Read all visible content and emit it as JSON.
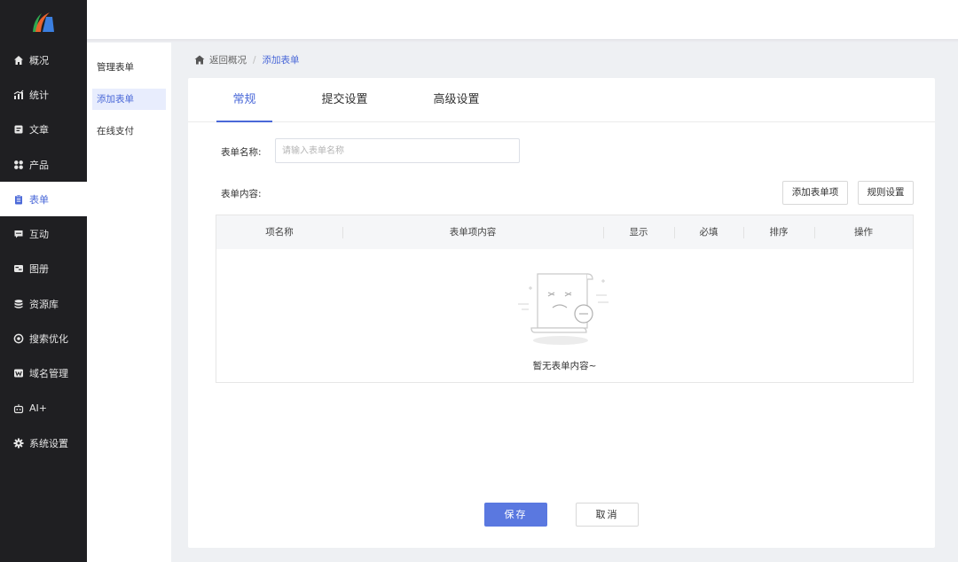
{
  "leftnav": {
    "items": [
      {
        "label": "概况",
        "icon": "home-icon"
      },
      {
        "label": "统计",
        "icon": "stats-icon"
      },
      {
        "label": "文章",
        "icon": "article-icon"
      },
      {
        "label": "产品",
        "icon": "grid-icon"
      },
      {
        "label": "表单",
        "icon": "clipboard-icon"
      },
      {
        "label": "互动",
        "icon": "chat-icon"
      },
      {
        "label": "图册",
        "icon": "gallery-icon"
      },
      {
        "label": "资源库",
        "icon": "database-icon"
      },
      {
        "label": "搜索优化",
        "icon": "target-icon"
      },
      {
        "label": "域名管理",
        "icon": "w-icon"
      },
      {
        "label": "AI+",
        "icon": "robot-icon"
      },
      {
        "label": "系统设置",
        "icon": "gear-icon"
      }
    ]
  },
  "subnav": {
    "items": [
      {
        "label": "管理表单"
      },
      {
        "label": "添加表单"
      },
      {
        "label": "在线支付"
      }
    ]
  },
  "breadcrumb": {
    "back": "返回概况",
    "sep": "/",
    "current": "添加表单"
  },
  "tabs": [
    {
      "label": "常规"
    },
    {
      "label": "提交设置"
    },
    {
      "label": "高级设置"
    }
  ],
  "form": {
    "name_label": "表单名称:",
    "name_placeholder": "请输入表单名称",
    "content_label": "表单内容:",
    "add_item_label": "添加表单项",
    "rule_settings_label": "规则设置"
  },
  "table": {
    "headers": [
      "项名称",
      "表单项内容",
      "显示",
      "必填",
      "排序",
      "操作"
    ],
    "empty_text": "暂无表单内容~"
  },
  "actions": {
    "save": "保存",
    "cancel": "取消"
  },
  "colors": {
    "accent": "#4a68d8",
    "primary_button": "#5a78e0",
    "nav_bg": "#1f1f22"
  }
}
